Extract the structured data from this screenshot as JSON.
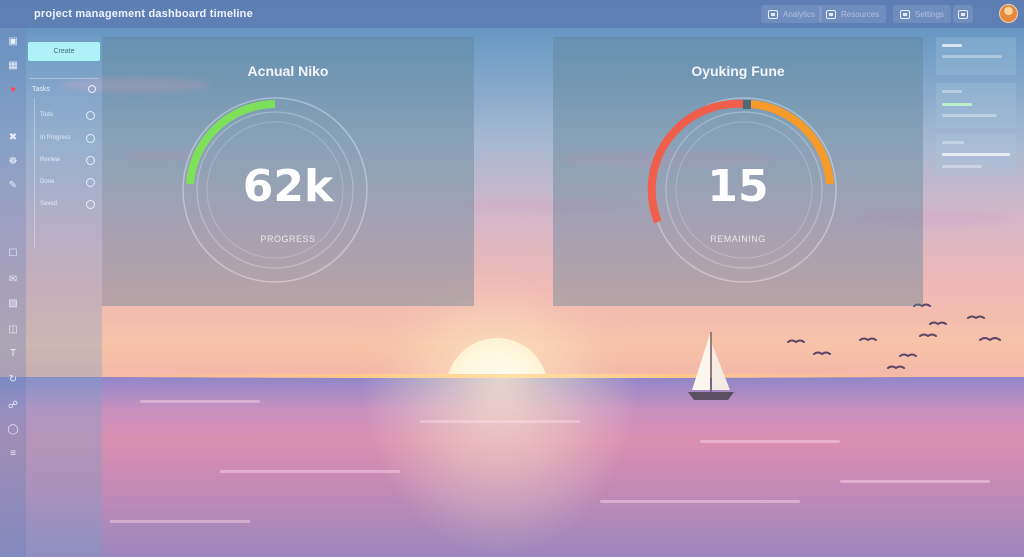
{
  "app": {
    "title": "project management dashboard timeline"
  },
  "topbar": {
    "btn1_label": "Analytics",
    "btn2_label": "Resources",
    "btn3_label": "Settings"
  },
  "panel": {
    "primary_label": "Create",
    "section_label": "Tasks",
    "items": [
      {
        "label": "Todo"
      },
      {
        "label": "In Progress"
      },
      {
        "label": "Review"
      },
      {
        "label": "Done"
      },
      {
        "label": "Saved"
      }
    ]
  },
  "gauges": [
    {
      "title": "Acnual Niko",
      "value": "62k",
      "caption": "PROGRESS",
      "color": "#7ee05a",
      "fraction": 0.4
    },
    {
      "title": "Oyuking Fune",
      "value": "15",
      "caption": "REMAINING",
      "color": "#f0855a",
      "fraction": 0.6
    }
  ],
  "colors": {
    "accent": "#aef1f6",
    "alert": "#ff4d4d",
    "gauge_green": "#7ee05a",
    "gauge_red": "#ef5f4b",
    "gauge_orange": "#f69a2a"
  }
}
